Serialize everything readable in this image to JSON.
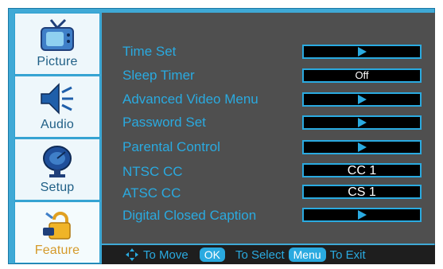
{
  "sidebar": {
    "tabs": [
      {
        "label": "Picture",
        "icon": "tv-icon"
      },
      {
        "label": "Audio",
        "icon": "speaker-icon"
      },
      {
        "label": "Setup",
        "icon": "satellite-dish-icon"
      },
      {
        "label": "Feature",
        "icon": "lock-feature-icon",
        "active": true
      }
    ]
  },
  "menu": {
    "rows": [
      {
        "label": "Time Set",
        "value": "",
        "type": "arrow"
      },
      {
        "label": "Sleep Timer",
        "value": "Off",
        "type": "value"
      },
      {
        "label": "Advanced Video Menu",
        "value": "",
        "type": "arrow"
      },
      {
        "label": "Password Set",
        "value": "",
        "type": "arrow"
      },
      {
        "label": "Parental Control",
        "value": "",
        "type": "arrow"
      },
      {
        "label": "NTSC CC",
        "value": "CC 1",
        "type": "value"
      },
      {
        "label": "ATSC CC",
        "value": "CS 1",
        "type": "value"
      },
      {
        "label": "Digital Closed Caption",
        "value": "",
        "type": "arrow"
      }
    ]
  },
  "footer": {
    "move_label": "To Move",
    "ok_key": "OK",
    "select_label": "To Select",
    "menu_key": "Menu",
    "exit_label": "To Exit"
  },
  "colors": {
    "accent": "#2aaae0",
    "active_tab_text": "#d59a2a",
    "panel": "#4f4f4f",
    "footer": "#1e1e1e"
  }
}
